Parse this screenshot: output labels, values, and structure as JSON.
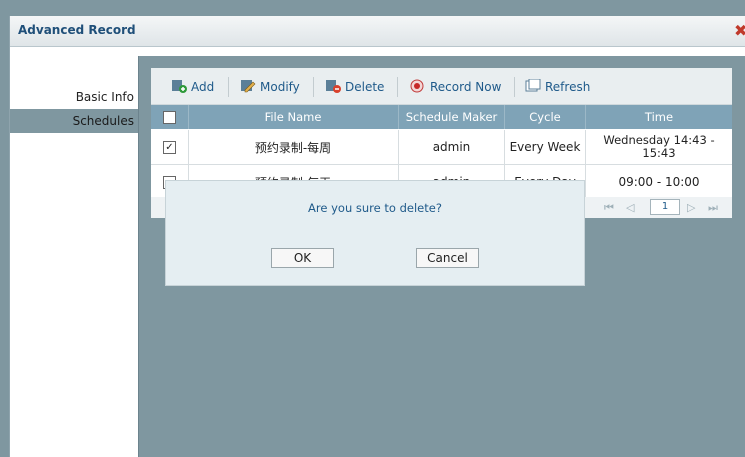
{
  "window": {
    "title": "Advanced Record",
    "close_label": "✖"
  },
  "sidebar": {
    "items": [
      {
        "label": "Basic Info"
      },
      {
        "label": "Schedules"
      }
    ]
  },
  "toolbar": {
    "add_label": "Add",
    "modify_label": "Modify",
    "delete_label": "Delete",
    "record_now_label": "Record Now",
    "refresh_label": "Refresh"
  },
  "table": {
    "columns": [
      "",
      "File Name",
      "Schedule Maker",
      "Cycle",
      "Time"
    ],
    "rows": [
      {
        "checked": "✓",
        "file_name": "预约录制-每周",
        "maker": "admin",
        "cycle": "Every Week",
        "time": "Wednesday 14:43 - 15:43"
      },
      {
        "checked": "",
        "file_name": "预约录制-每天",
        "maker": "admin",
        "cycle": "Every Day",
        "time": "09:00 - 10:00"
      }
    ]
  },
  "pager": {
    "page": "1"
  },
  "dialog": {
    "message": "Are you sure to delete?",
    "ok_label": "OK",
    "cancel_label": "Cancel"
  },
  "colors": {
    "accent": "#1f5a8a",
    "grid_bg": "#7f97a0",
    "header_bg": "#7fa3b7",
    "close": "#c0392b"
  }
}
